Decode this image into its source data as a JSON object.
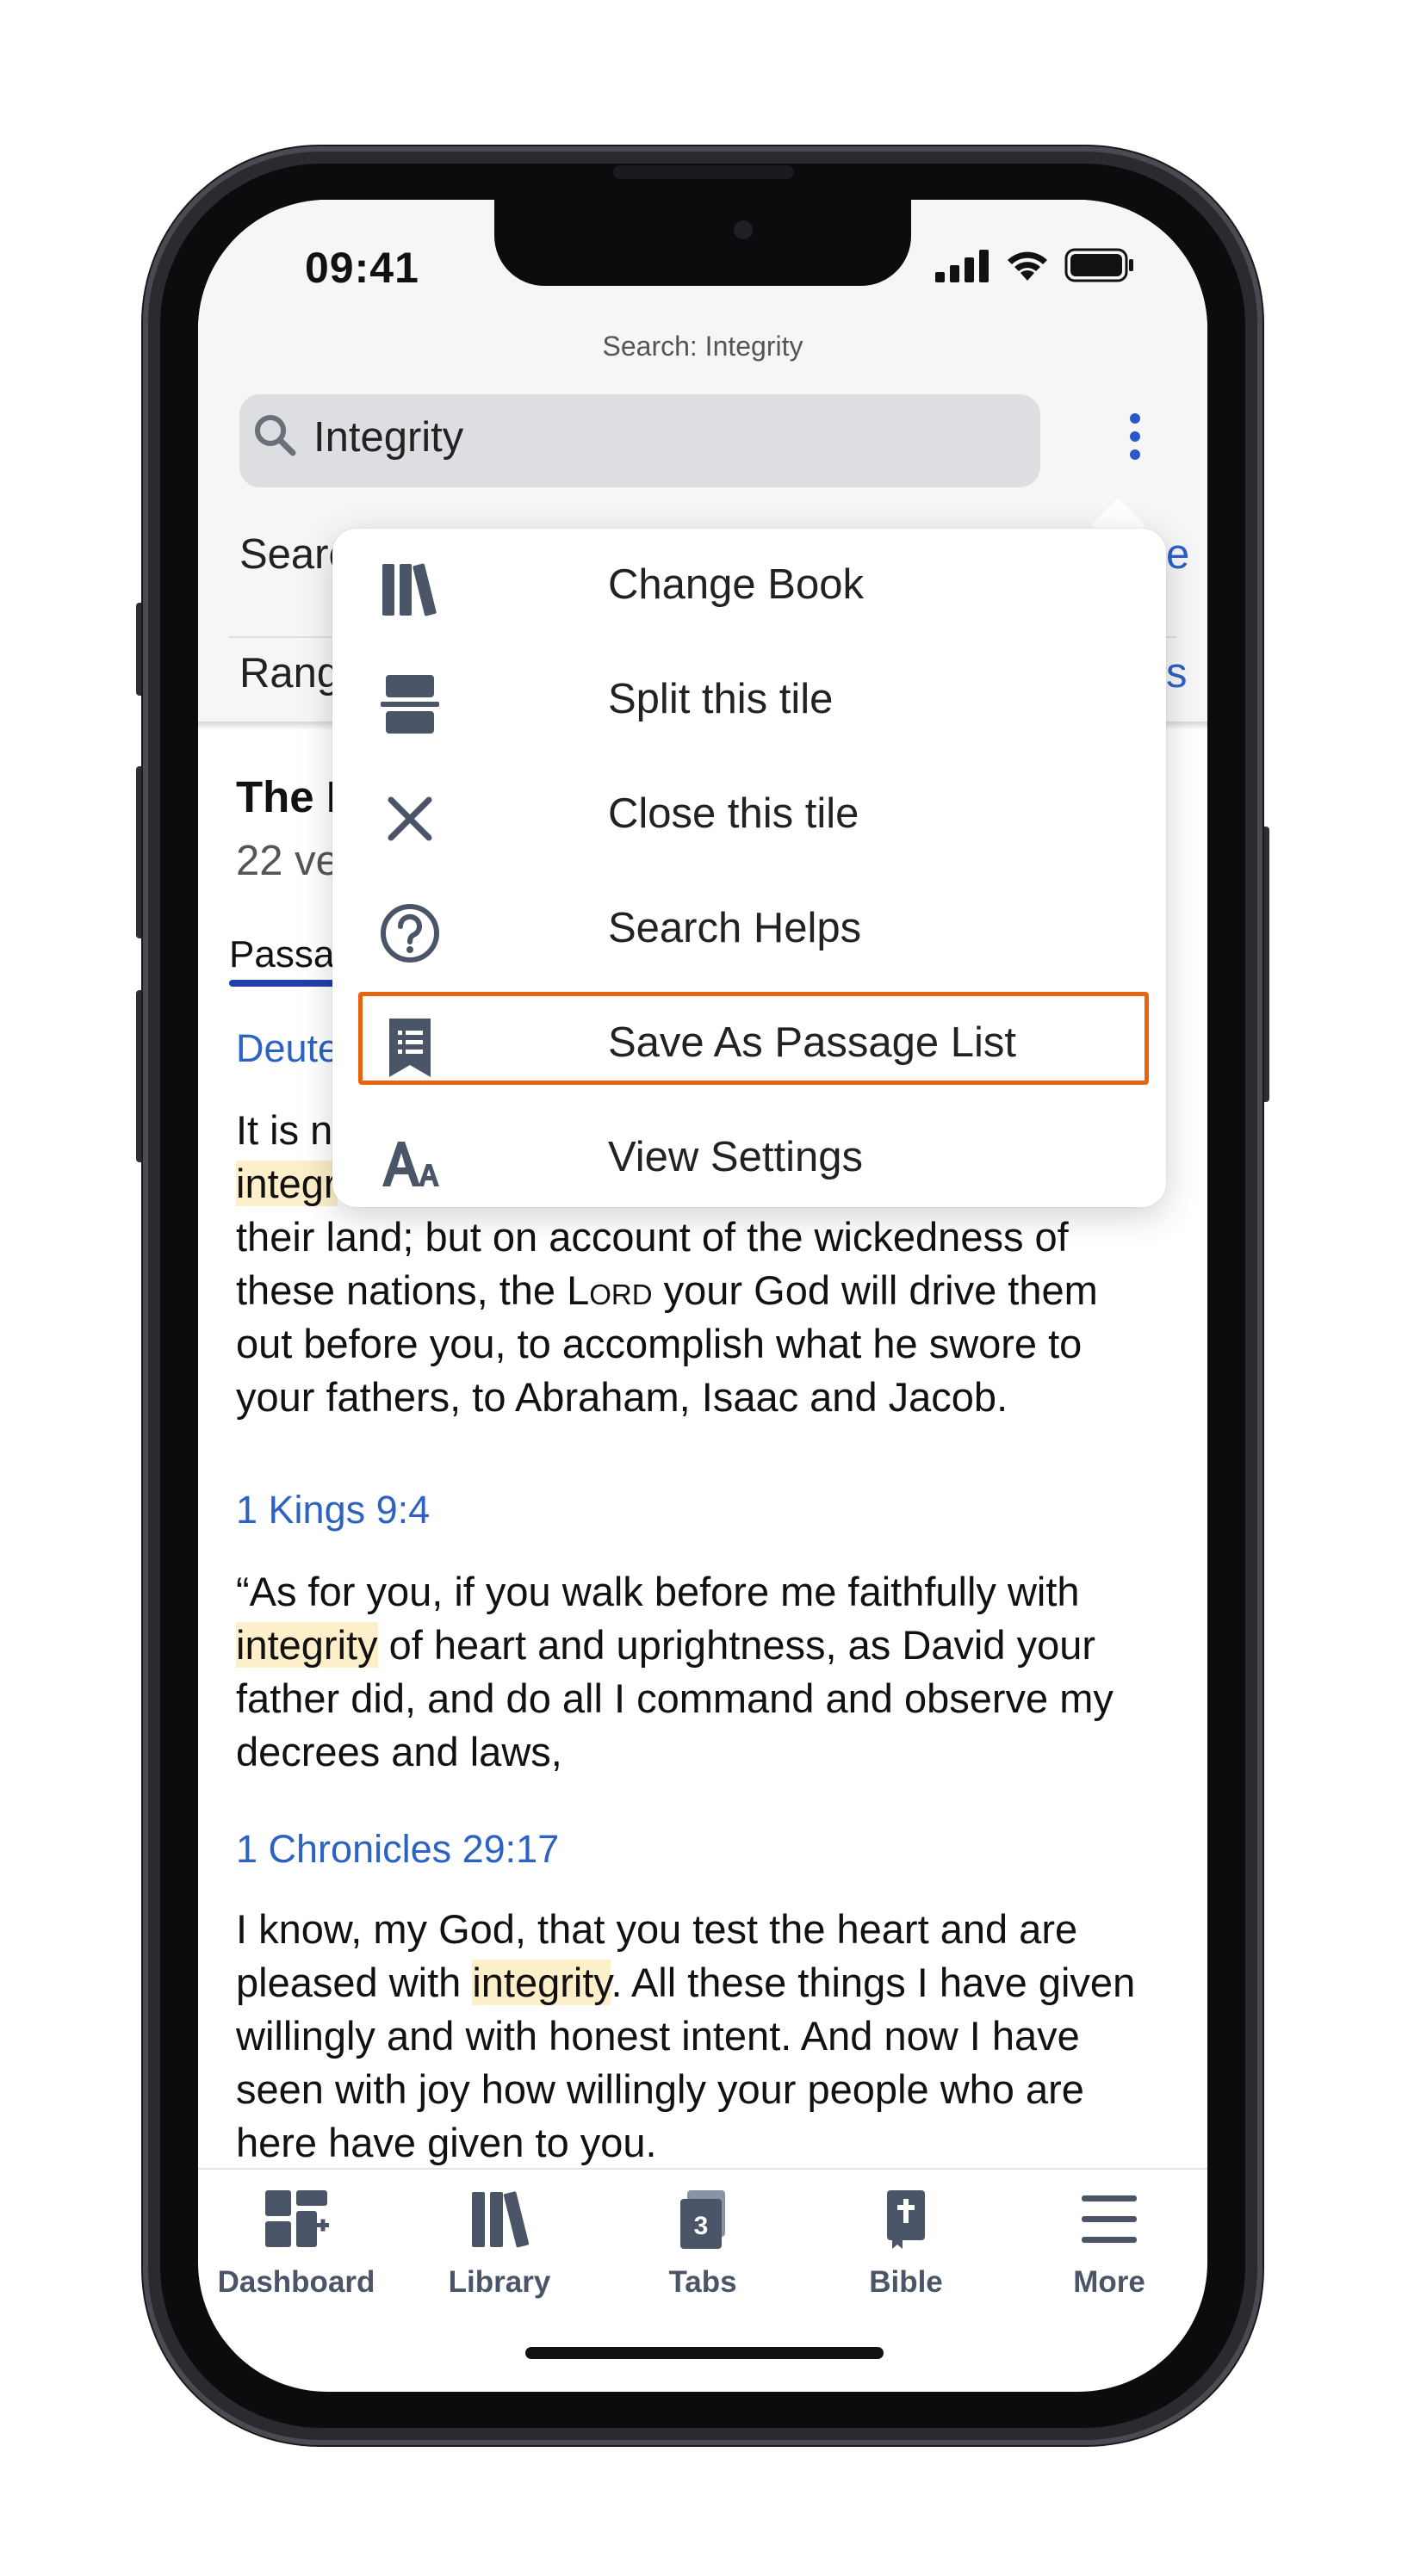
{
  "status_bar": {
    "time": "09:41"
  },
  "header": {
    "title": "Search: Integrity",
    "search_value": "Integrity",
    "row_search_label": "Searc",
    "row_search_value_partial": "e",
    "row_range_label": "Rang",
    "row_range_value_partial": "s"
  },
  "results": {
    "heading_partial": "The I",
    "count_partial": "22 ve",
    "tab_passages_partial": "Passa",
    "first_ref_partial": "Deute",
    "first_line_partial": "It is n",
    "second_line_partial": "integr",
    "deut_lines": [
      "their land; but on account of the wickedness of",
      "these nations, the",
      "your God will drive them",
      "out before you, to accomplish what he swore to",
      "your fathers, to Abraham, Isaac and Jacob."
    ],
    "lord": "Lord",
    "kings_ref": "1 Kings 9:4",
    "kings_line1": "“As for you, if you walk before me faithfully with",
    "kings_hl": "integrity",
    "kings_line2_rest": " of heart and uprightness, as David your",
    "kings_line3": "father did, and do all I command and observe my",
    "kings_line4": "decrees and laws,",
    "chron_ref": "1 Chronicles 29:17",
    "chron_line1": "I know, my God, that you test the heart and are",
    "chron_line2_pre": "pleased with ",
    "chron_hl": "integrity",
    "chron_line2_post": ". All these things I have given",
    "chron_line3": "willingly and with honest intent. And now I have",
    "chron_line4": "seen with joy how willingly your people who are",
    "chron_line5": "here have given to you."
  },
  "menu": {
    "items": [
      {
        "label": "Change Book",
        "icon": "books-icon"
      },
      {
        "label": "Split this tile",
        "icon": "split-icon"
      },
      {
        "label": "Close this tile",
        "icon": "close-icon"
      },
      {
        "label": "Search Helps",
        "icon": "help-icon"
      },
      {
        "label": "Save As Passage List",
        "icon": "passage-list-icon"
      },
      {
        "label": "View Settings",
        "icon": "text-size-icon"
      }
    ],
    "highlight_color": "#e8650f"
  },
  "tabbar": {
    "items": [
      {
        "label": "Dashboard",
        "icon": "dashboard-icon"
      },
      {
        "label": "Library",
        "icon": "library-icon"
      },
      {
        "label": "Tabs",
        "icon": "tabs-icon",
        "badge": "3"
      },
      {
        "label": "Bible",
        "icon": "bible-icon"
      },
      {
        "label": "More",
        "icon": "menu-icon"
      }
    ]
  },
  "colors": {
    "accent": "#2b62c3",
    "highlight": "#fcefc9",
    "icon": "#4b5568"
  }
}
